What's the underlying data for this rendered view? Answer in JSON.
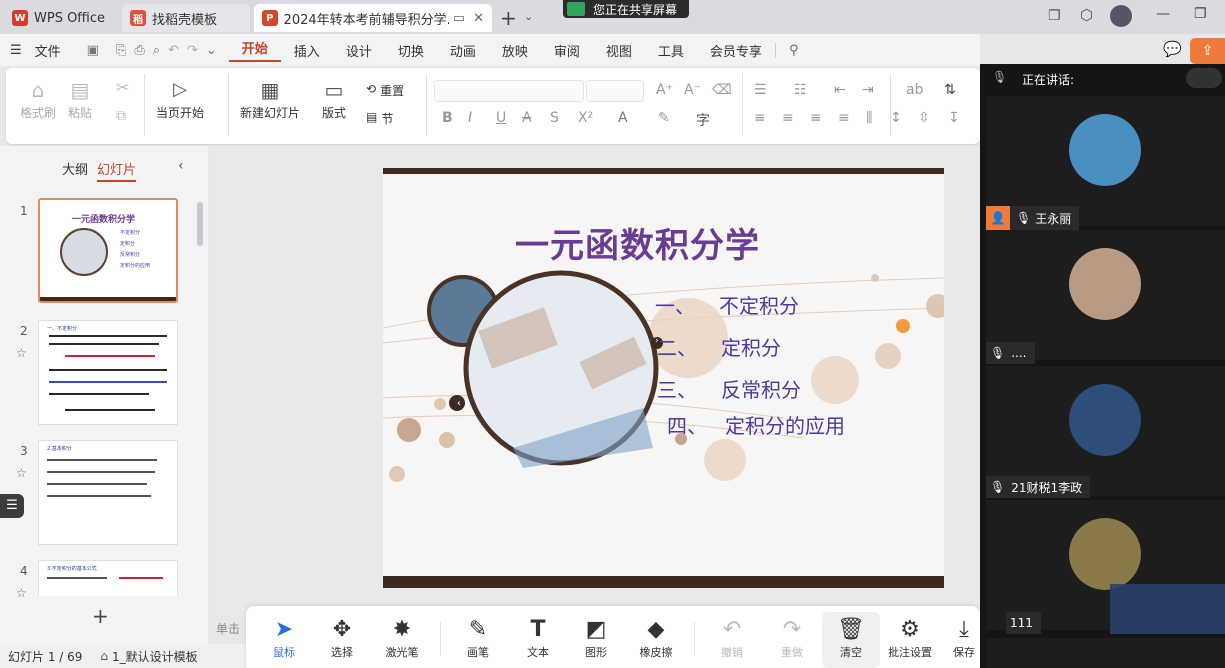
{
  "titlebar": {
    "tabs": [
      {
        "label": "WPS Office"
      },
      {
        "label": "找稻壳模板"
      },
      {
        "label": "2024年转本考前辅导积分学.p"
      }
    ],
    "share_banner": "您正在共享屏幕"
  },
  "menubar": {
    "file": "文件",
    "items": [
      "开始",
      "插入",
      "设计",
      "切换",
      "动画",
      "放映",
      "审阅",
      "视图",
      "工具",
      "会员专享"
    ],
    "active": "开始"
  },
  "ribbon": {
    "format_painter": "格式刷",
    "paste": "粘贴",
    "play_from_current": "当页开始",
    "new_slide": "新建幻灯片",
    "layout": "版式",
    "reset": "重置",
    "section": "节"
  },
  "left_panel": {
    "tab_outline": "大纲",
    "tab_slides": "幻灯片",
    "thumbs": [
      {
        "num": "1",
        "title": "一元函数积分学",
        "lines": [
          "不定积分",
          "定积分",
          "反常积分",
          "定积分的应用"
        ]
      },
      {
        "num": "2",
        "title": "一、不定积分"
      },
      {
        "num": "3",
        "title": "2.基本积分"
      },
      {
        "num": "4",
        "title": "3.不定积分的基本公式"
      }
    ],
    "add_label": "+"
  },
  "slide": {
    "title": "一元函数积分学",
    "items": [
      {
        "num": "一、",
        "text": "不定积分"
      },
      {
        "num": "二、",
        "text": "定积分"
      },
      {
        "num": "三、",
        "text": "反常积分"
      },
      {
        "num": "四、",
        "text": "定积分的应用"
      }
    ]
  },
  "status": {
    "slide_count": "幻灯片 1 / 69",
    "template": "1_默认设计模板",
    "notes_hint": "单击"
  },
  "annotation_toolbar": {
    "tools": [
      {
        "label": "鼠标",
        "icon": "pointer-icon",
        "active": true
      },
      {
        "label": "选择",
        "icon": "move-icon"
      },
      {
        "label": "激光笔",
        "icon": "laser-icon"
      },
      {
        "label": "画笔",
        "icon": "pen-icon"
      },
      {
        "label": "文本",
        "icon": "text-icon"
      },
      {
        "label": "图形",
        "icon": "shape-icon"
      },
      {
        "label": "橡皮擦",
        "icon": "eraser-icon"
      },
      {
        "label": "撤销",
        "icon": "undo-icon",
        "disabled": true
      },
      {
        "label": "重做",
        "icon": "redo-icon",
        "disabled": true
      },
      {
        "label": "清空",
        "icon": "trash-icon"
      },
      {
        "label": "批注设置",
        "icon": "settings-icon"
      },
      {
        "label": "保存",
        "icon": "save-icon"
      }
    ]
  },
  "meeting": {
    "speaking_label": "正在讲话:",
    "participants": [
      {
        "name": "",
        "color": "#4a8fc1"
      },
      {
        "name": "王永丽",
        "color": "#b89a85"
      },
      {
        "name": "....",
        "color": "#2d4e7a"
      },
      {
        "name": "21财税1李政",
        "color": "#8a7a4a"
      },
      {
        "name": "111",
        "color": "#444"
      }
    ]
  },
  "colors": {
    "accent": "#c0462b",
    "slide_title": "#6a3b93",
    "slide_text": "#4a3aa0",
    "orange_dot": "#f39c3b"
  }
}
